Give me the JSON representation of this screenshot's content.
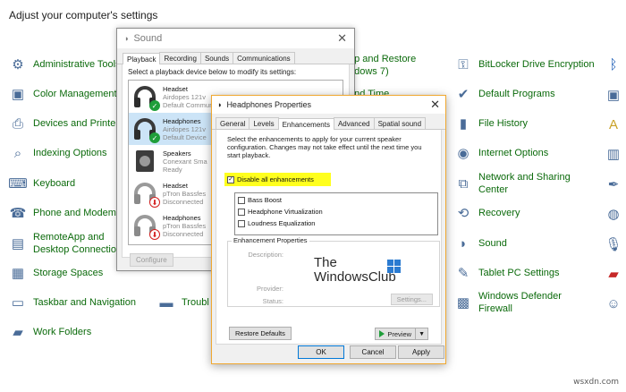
{
  "header": {
    "title": "Adjust your computer's settings"
  },
  "left_items": [
    {
      "label": "Administrative Tools",
      "icon": "admin-tools-icon",
      "glyph": "⚙"
    },
    {
      "label": "Color Management",
      "icon": "color-management-icon",
      "glyph": "▣"
    },
    {
      "label": "Devices and Printers",
      "icon": "devices-printers-icon",
      "glyph": "⎙"
    },
    {
      "label": "Indexing Options",
      "icon": "indexing-icon",
      "glyph": "⌕"
    },
    {
      "label": "Keyboard",
      "icon": "keyboard-icon",
      "glyph": "⌨"
    },
    {
      "label": "Phone and Modem",
      "icon": "phone-icon",
      "glyph": "☎"
    },
    {
      "label": "RemoteApp and Desktop Connections",
      "icon": "remoteapp-icon",
      "glyph": "▤"
    },
    {
      "label": "Storage Spaces",
      "icon": "storage-icon",
      "glyph": "▦"
    },
    {
      "label": "Taskbar and Navigation",
      "icon": "taskbar-icon",
      "glyph": "▭"
    },
    {
      "label": "Work Folders",
      "icon": "work-folders-icon",
      "glyph": "▰"
    }
  ],
  "middle_partial": [
    {
      "label": "up and Restore",
      "icon": "backup-icon"
    },
    {
      "label": "ndows 7)"
    },
    {
      "label": "and Time"
    },
    {
      "label": "Troubl",
      "icon": "troubleshooting-icon"
    }
  ],
  "right_items": [
    {
      "label": "BitLocker Drive Encryption",
      "icon": "bitlocker-icon",
      "glyph": "⚿"
    },
    {
      "label": "Default Programs",
      "icon": "default-programs-icon",
      "glyph": "✔"
    },
    {
      "label": "File History",
      "icon": "file-history-icon",
      "glyph": "▮"
    },
    {
      "label": "Internet Options",
      "icon": "internet-options-icon",
      "glyph": "◉"
    },
    {
      "label": "Network and Sharing Center",
      "icon": "network-sharing-icon",
      "glyph": "⧉"
    },
    {
      "label": "Recovery",
      "icon": "recovery-icon",
      "glyph": "⟲"
    },
    {
      "label": "Sound",
      "icon": "sound-icon",
      "glyph": "◗"
    },
    {
      "label": "Tablet PC Settings",
      "icon": "tablet-icon",
      "glyph": "✎"
    },
    {
      "label": "Windows Defender Firewall",
      "icon": "firewall-icon",
      "glyph": "▩"
    }
  ],
  "far_right_icons": [
    "bluetooth-icon",
    "device-icon",
    "font-icon",
    "keyboard-alt-icon",
    "pen-icon",
    "globe-icon",
    "microphone-icon",
    "taskbar-alt-icon",
    "user-icon"
  ],
  "sound_dialog": {
    "title": "Sound",
    "tabs": [
      "Playback",
      "Recording",
      "Sounds",
      "Communications"
    ],
    "active_tab": "Playback",
    "instruction": "Select a playback device below to modify its settings:",
    "devices": [
      {
        "name": "Headset",
        "sub1": "Airdopes 121v",
        "sub2": "Default Communi",
        "status": "green"
      },
      {
        "name": "Headphones",
        "sub1": "Airdopes 121v",
        "sub2": "Default Device",
        "status": "green"
      },
      {
        "name": "Speakers",
        "sub1": "Conexant Sma",
        "sub2": "Ready",
        "status": "none"
      },
      {
        "name": "Headset",
        "sub1": "pTron Bassfes",
        "sub2": "Disconnected",
        "status": "red"
      },
      {
        "name": "Headphones",
        "sub1": "pTron Bassfes",
        "sub2": "Disconnected",
        "status": "red"
      }
    ],
    "configure_label": "Configure"
  },
  "hp_dialog": {
    "title": "Headphones Properties",
    "tabs": [
      "General",
      "Levels",
      "Enhancements",
      "Advanced",
      "Spatial sound"
    ],
    "active_tab": "Enhancements",
    "description": "Select the enhancements to apply for your current speaker configuration. Changes may not take effect until the next time you start playback.",
    "disable_all_label": "Disable all enhancements",
    "disable_all_checked": "✓",
    "enhancements": [
      "Bass Boost",
      "Headphone Virtualization",
      "Loudness Equalization"
    ],
    "group_title": "Enhancement Properties",
    "description_label": "Description:",
    "provider_label": "Provider:",
    "status_label": "Status:",
    "settings_label": "Settings...",
    "watermark_line1": "The",
    "watermark_line2": "WindowsClub",
    "restore_label": "Restore Defaults",
    "preview_label": "Preview",
    "ok_label": "OK",
    "cancel_label": "Cancel",
    "apply_label": "Apply"
  },
  "watermark_site": "wsxdn.com",
  "colors": {
    "link_green": "#0b6a0b",
    "highlight": "#ffff1e",
    "accent_border": "#f0a830"
  }
}
